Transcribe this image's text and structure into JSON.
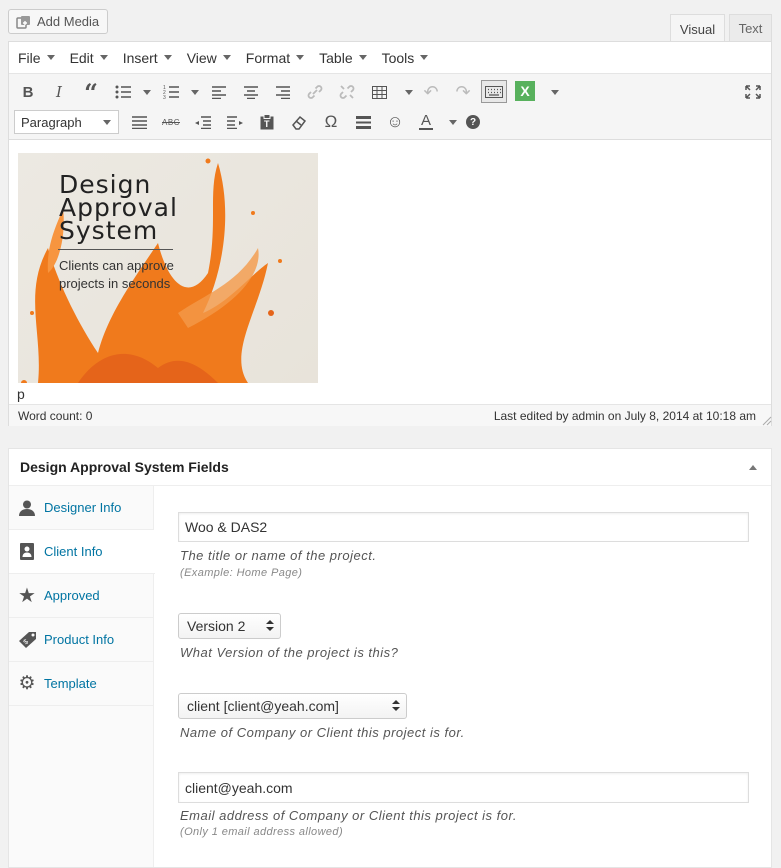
{
  "top": {
    "add_media_label": "Add Media",
    "tabs": [
      {
        "label": "Visual",
        "active": true
      },
      {
        "label": "Text",
        "active": false
      }
    ]
  },
  "menubar": {
    "items": [
      "File",
      "Edit",
      "Insert",
      "View",
      "Format",
      "Table",
      "Tools"
    ]
  },
  "toolbar": {
    "format_select": "Paragraph",
    "row1_icons": [
      "bold-icon",
      "italic-icon",
      "blockquote-icon",
      "bullet-list-icon",
      "numbered-list-icon",
      "align-left-icon",
      "align-center-icon",
      "align-right-icon",
      "link-icon",
      "unlink-icon",
      "table-icon",
      "undo-icon",
      "redo-icon",
      "keyboard-icon",
      "excel-icon",
      "fullscreen-icon"
    ],
    "row2_icons": [
      "justify-icon",
      "strikethrough-icon",
      "outdent-icon",
      "indent-icon",
      "paste-text-icon",
      "clear-formatting-icon",
      "omega-icon",
      "horizontal-rule-icon",
      "emoticon-icon",
      "text-color-icon",
      "help-icon"
    ]
  },
  "content": {
    "image": {
      "title_lines": [
        "Design",
        "Approval",
        "System"
      ],
      "subtitle": "Clients can approve projects in seconds"
    },
    "paragraph_text": "p"
  },
  "status": {
    "word_count": "Word count: 0",
    "last_edited": "Last edited by admin on July 8, 2014 at 10:18 am"
  },
  "metabox": {
    "title": "Design Approval System Fields",
    "tabs": [
      {
        "label": "Designer Info",
        "icon": "person-icon"
      },
      {
        "label": "Client Info",
        "icon": "id-card-icon"
      },
      {
        "label": "Approved",
        "icon": "star-icon"
      },
      {
        "label": "Product Info",
        "icon": "price-tag-icon"
      },
      {
        "label": "Template",
        "icon": "gear-icon"
      }
    ],
    "fields": {
      "project_name": {
        "value": "Woo & DAS2",
        "desc": "The title or name of the project.",
        "hint": "(Example: Home Page)"
      },
      "version": {
        "value": "Version 2",
        "desc": "What Version of the project is this?"
      },
      "client": {
        "value": "client [client@yeah.com]",
        "desc": "Name of Company or Client this project is for."
      },
      "email": {
        "value": "client@yeah.com",
        "desc": "Email address of Company or Client this project is for.",
        "hint": "(Only 1 email address allowed)"
      }
    }
  }
}
